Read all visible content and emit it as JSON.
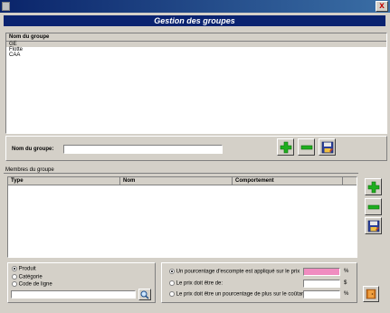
{
  "window": {
    "close_label": "x"
  },
  "header": {
    "title": "Gestion des groupes"
  },
  "groups": {
    "column": "Nom du groupe",
    "rows": [
      "GE",
      "Flotte",
      "CAA"
    ]
  },
  "group_name": {
    "label": "Nom du groupe:",
    "value": ""
  },
  "members": {
    "legend": "Membres du groupe",
    "columns": [
      "Type",
      "Nom",
      "Comportement"
    ]
  },
  "type_options": [
    "Produit",
    "Catégorie",
    "Code de ligne"
  ],
  "pricing": {
    "options": [
      "Un pourcentage d'escompte est appliqué sur le prix",
      "Le prix doit être de:",
      "Le prix doit être un pourcentage de plus sur le coûtant:"
    ],
    "units": [
      "%",
      "$",
      "%"
    ]
  },
  "colors": {
    "add": "#1fae1f",
    "remove": "#1fae1f",
    "highlight": "#f08cc0",
    "header": "#0a2370"
  }
}
